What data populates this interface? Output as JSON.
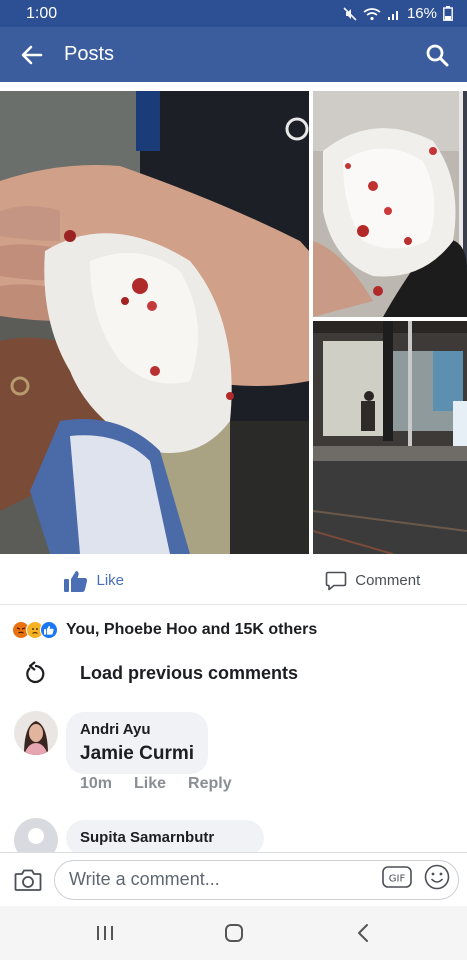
{
  "status_bar": {
    "time": "1:00",
    "battery": "16%",
    "icons": [
      "mute-icon",
      "wifi-icon",
      "signal-icon",
      "battery-icon"
    ]
  },
  "header": {
    "title": "Posts",
    "back_icon": "arrow-left-icon",
    "search_icon": "search-icon",
    "background": "#3b5d9e"
  },
  "photos": [
    {
      "description_name": "photo-hand-tissue"
    },
    {
      "description_name": "photo-tissue-closeup"
    },
    {
      "description_name": "photo-street-night"
    }
  ],
  "actions": {
    "like_label": "Like",
    "comment_label": "Comment",
    "like_color": "#4a6fb5"
  },
  "reactions": {
    "icons": [
      "angry-react-icon",
      "sad-react-icon",
      "like-react-icon"
    ],
    "summary": "You, Phoebe Hoo and 15K others"
  },
  "load_previous": {
    "label": "Load previous comments"
  },
  "comments": [
    {
      "author": "Andri Ayu",
      "text": "Jamie Curmi",
      "time": "10m",
      "like_label": "Like",
      "reply_label": "Reply"
    },
    {
      "author": "Supita Samarnbutr"
    }
  ],
  "composer": {
    "placeholder": "Write a comment...",
    "gif_label": "GIF"
  },
  "nav": {
    "icons": [
      "recent-apps-icon",
      "home-icon",
      "back-icon"
    ]
  }
}
